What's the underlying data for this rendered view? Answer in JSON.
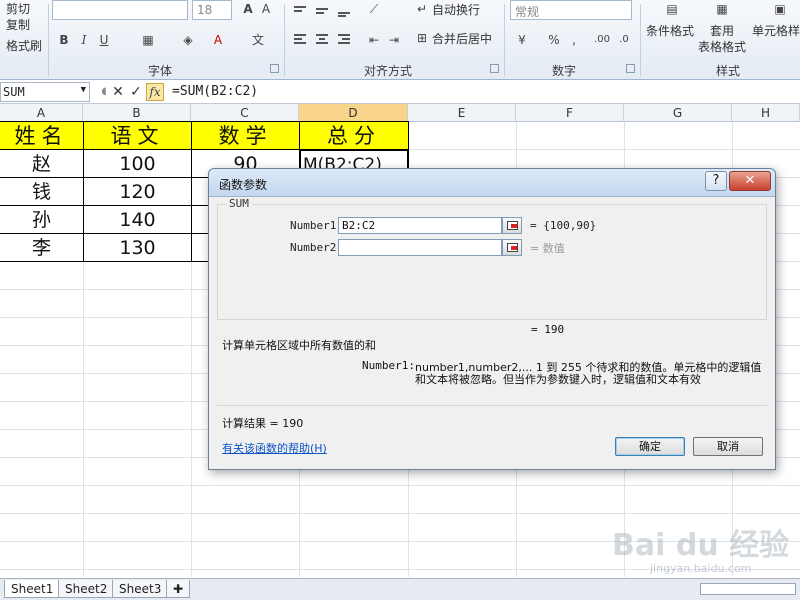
{
  "ribbon": {
    "cut_label": "剪切",
    "copy_label": "复制",
    "format_painter_label": "格式刷",
    "font_size": "18",
    "wrap_text_label": "自动换行",
    "merge_center_label": "合并后居中",
    "number_format": "常规",
    "conditional_format_label": "条件格式",
    "format_as_table_label_1": "套用",
    "format_as_table_label_2": "表格格式",
    "cell_styles_label": "单元格样式",
    "groups": {
      "font": "字体",
      "alignment": "对齐方式",
      "number": "数字",
      "styles": "样式"
    }
  },
  "formula_bar": {
    "name_box": "SUM",
    "formula": "=SUM(B2:C2)"
  },
  "columns": [
    "A",
    "B",
    "C",
    "D",
    "E",
    "F",
    "G",
    "H"
  ],
  "table": {
    "headers": [
      "姓名",
      "语文",
      "数学",
      "总分"
    ],
    "rows": [
      {
        "name": "赵",
        "chinese": "100",
        "math": "90",
        "total": "=SUM(B2:C2)"
      },
      {
        "name": "钱",
        "chinese": "120"
      },
      {
        "name": "孙",
        "chinese": "140"
      },
      {
        "name": "李",
        "chinese": "130"
      }
    ],
    "d2_display": "M(B2:C2)"
  },
  "dialog": {
    "title": "函数参数",
    "function_name": "SUM",
    "arg1_label": "Number1",
    "arg1_value": "B2:C2",
    "arg1_result": "= {100,90}",
    "arg2_label": "Number2",
    "arg2_value": "",
    "arg2_result": "= 数值",
    "formula_result_line": "= 190",
    "description": "计算单元格区域中所有数值的和",
    "param_label": "Number1:",
    "param_desc_1": "number1,number2,...  1 到 255 个待求和的数值。单元格中的逻辑值",
    "param_desc_2": "和文本将被忽略。但当作为参数键入时，逻辑值和文本有效",
    "calc_result": "计算结果 = 190",
    "help_link": "有关该函数的帮助(H)",
    "ok_label": "确定",
    "cancel_label": "取消",
    "help_glyph": "?",
    "close_glyph": "✕"
  },
  "sheets": [
    "Sheet1",
    "Sheet2",
    "Sheet3"
  ],
  "watermark": {
    "main": "Bai du 经验",
    "sub": "jingyan.baidu.com"
  }
}
